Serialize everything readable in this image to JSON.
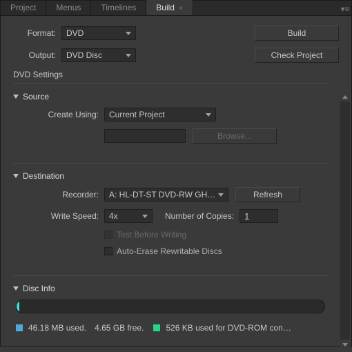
{
  "tabs": {
    "project": "Project",
    "menus": "Menus",
    "timelines": "Timelines",
    "build": "Build"
  },
  "topRow": {
    "formatLabel": "Format:",
    "formatValue": "DVD",
    "outputLabel": "Output:",
    "outputValue": "DVD Disc",
    "buildBtn": "Build",
    "checkBtn": "Check Project"
  },
  "settingsTitle": "DVD Settings",
  "source": {
    "title": "Source",
    "createUsingLabel": "Create Using:",
    "createUsingValue": "Current Project",
    "pathValue": "",
    "browseBtn": "Browse..."
  },
  "destination": {
    "title": "Destination",
    "recorderLabel": "Recorder:",
    "recorderValue": "A: HL-DT-ST DVD-RW GH…",
    "refreshBtn": "Refresh",
    "writeSpeedLabel": "Write Speed:",
    "writeSpeedValue": "4x",
    "copiesLabel": "Number of Copies:",
    "copiesValue": "1",
    "testBefore": "Test Before Writing",
    "autoErase": "Auto-Erase Rewritable Discs"
  },
  "discInfo": {
    "title": "Disc Info",
    "used": "46.18 MB used.",
    "free": "4.65 GB free.",
    "rom": "526 KB used for DVD-ROM con…"
  }
}
